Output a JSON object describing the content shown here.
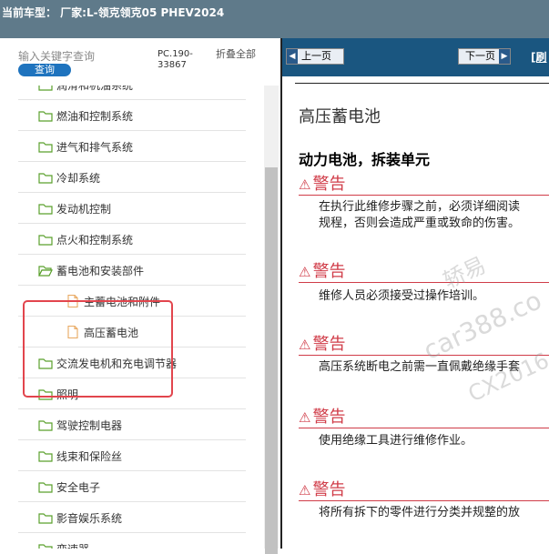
{
  "window": {
    "title": "当前车型：  厂家:L-领克领克05 PHEV2024"
  },
  "sidebar": {
    "search_placeholder": "输入关键字查询",
    "search_button": "查询",
    "pc_code": "PC.190-33867",
    "fold_all": "折叠全部",
    "items": [
      {
        "label": "润滑和机油系统",
        "level": 0,
        "icon": "folder-icon"
      },
      {
        "label": "燃油和控制系统",
        "level": 0,
        "icon": "folder-icon"
      },
      {
        "label": "进气和排气系统",
        "level": 0,
        "icon": "folder-icon"
      },
      {
        "label": "冷却系统",
        "level": 0,
        "icon": "folder-icon"
      },
      {
        "label": "发动机控制",
        "level": 0,
        "icon": "folder-icon"
      },
      {
        "label": "点火和控制系统",
        "level": 0,
        "icon": "folder-icon"
      },
      {
        "label": "蓄电池和安装部件",
        "level": 0,
        "icon": "folder-open-icon"
      },
      {
        "label": "主蓄电池和附件",
        "level": 1,
        "icon": "document-icon"
      },
      {
        "label": "高压蓄电池",
        "level": 1,
        "icon": "document-icon"
      },
      {
        "label": "交流发电机和充电调节器",
        "level": 0,
        "icon": "folder-icon"
      },
      {
        "label": "照明",
        "level": 0,
        "icon": "folder-icon"
      },
      {
        "label": "驾驶控制电器",
        "level": 0,
        "icon": "folder-icon"
      },
      {
        "label": "线束和保险丝",
        "level": 0,
        "icon": "folder-icon"
      },
      {
        "label": "安全电子",
        "level": 0,
        "icon": "folder-icon"
      },
      {
        "label": "影音娱乐系统",
        "level": 0,
        "icon": "folder-icon"
      },
      {
        "label": "变速器",
        "level": 0,
        "icon": "folder-icon"
      }
    ]
  },
  "content": {
    "prev_button": "上一页",
    "next_button": "下一页",
    "refresh_link": "[刷",
    "doc_title": "高压蓄电池",
    "section_title": "动力电池，拆装单元",
    "warnings": [
      {
        "heading": "警告",
        "lines": [
          "在执行此维修步骤之前，必须详细阅读",
          "规程，否则会造成严重或致命的伤害。"
        ]
      },
      {
        "heading": "警告",
        "lines": [
          "维修人员必须接受过操作培训。"
        ]
      },
      {
        "heading": "警告",
        "lines": [
          "高压系统断电之前需一直佩戴绝缘手套"
        ]
      },
      {
        "heading": "警告",
        "lines": [
          "使用绝缘工具进行维修作业。"
        ]
      },
      {
        "heading": "警告",
        "lines": [
          "将所有拆下的零件进行分类并规整的放"
        ]
      }
    ],
    "watermarks": [
      "轿易",
      "car388.co",
      "CX2016"
    ]
  },
  "colors": {
    "titlebar": "#5f7a8a",
    "navbar": "#1a5680",
    "warning": "#d03c48",
    "highlight": "#e2454d",
    "search_button": "#1e73be",
    "folder": "#5aa02c",
    "document": "#e8a860"
  }
}
